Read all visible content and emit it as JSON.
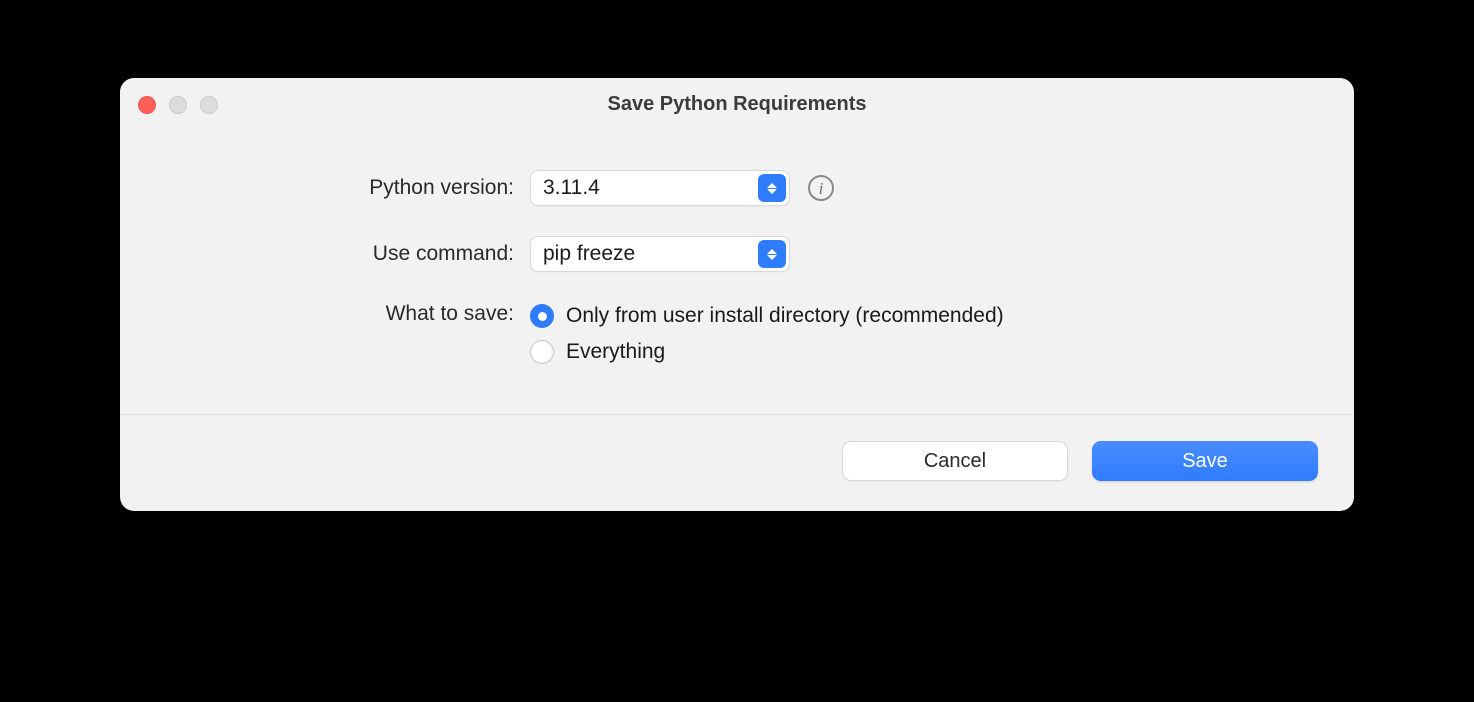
{
  "dialog": {
    "title": "Save Python Requirements"
  },
  "form": {
    "python_version": {
      "label": "Python version:",
      "value": "3.11.4"
    },
    "use_command": {
      "label": "Use command:",
      "value": "pip freeze"
    },
    "what_to_save": {
      "label": "What to save:",
      "options": [
        {
          "label": "Only from user install directory (recommended)",
          "selected": true
        },
        {
          "label": "Everything",
          "selected": false
        }
      ]
    }
  },
  "footer": {
    "cancel": "Cancel",
    "save": "Save"
  },
  "icons": {
    "info_glyph": "i"
  }
}
